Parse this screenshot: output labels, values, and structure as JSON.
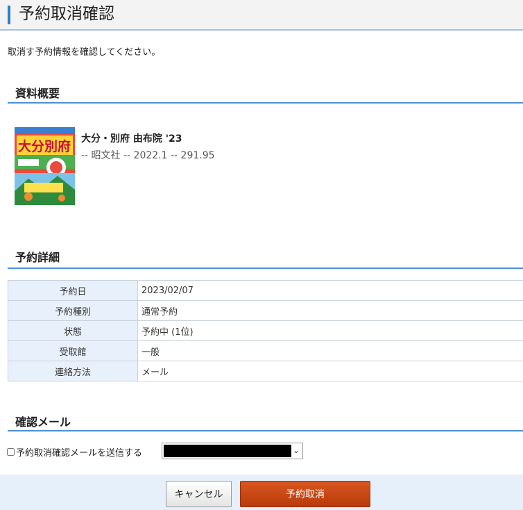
{
  "header": {
    "title": "予約取消確認"
  },
  "intro_text": "取消す予約情報を確認してください。",
  "material": {
    "section_title": "資料概要",
    "book_title": "大分・別府 由布院 '23",
    "book_meta": "-- 昭文社 -- 2022.1 -- 291.95",
    "cover_text": "大分別府"
  },
  "reservation": {
    "section_title": "予約詳細",
    "rows": [
      {
        "label": "予約日",
        "value": "2023/02/07"
      },
      {
        "label": "予約種別",
        "value": "通常予約"
      },
      {
        "label": "状態",
        "value": "予約中 (1位)"
      },
      {
        "label": "受取館",
        "value": "一般"
      },
      {
        "label": "連絡方法",
        "value": "メール"
      }
    ]
  },
  "confirm_mail": {
    "section_title": "確認メール",
    "checkbox_label": "予約取消確認メールを送信する"
  },
  "buttons": {
    "cancel_label": "キャンセル",
    "submit_label": "予約取消"
  },
  "colors": {
    "accent": "#2f80c3",
    "section_rule": "#4f8fd1",
    "submit_button": "#c84714",
    "footer_bg": "#e6f0fa",
    "table_label_bg": "#e8f1fb"
  }
}
